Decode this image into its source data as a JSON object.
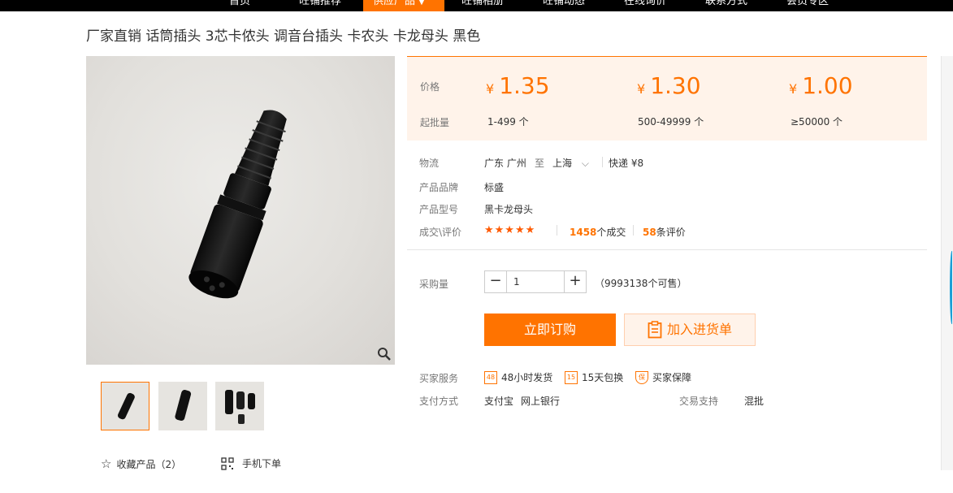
{
  "nav": {
    "items": [
      "首页",
      "旺铺推荐",
      "供应产品",
      "旺铺相册",
      "旺铺动态",
      "在线询价",
      "联系方式",
      "会员专区"
    ],
    "active_caret": "▼"
  },
  "product": {
    "title": "厂家直销 话筒插头 3芯卡侬头 调音台插头 卡农头 卡龙母头 黑色"
  },
  "price": {
    "price_label": "价格",
    "moq_label": "起批量",
    "currency": "¥",
    "tiers": [
      {
        "price": "1.35",
        "qty": "1-499 个"
      },
      {
        "price": "1.30",
        "qty": "500-49999 个"
      },
      {
        "price": "1.00",
        "qty": "≥50000 个"
      }
    ]
  },
  "logistics": {
    "label": "物流",
    "origin": "广东 广州",
    "to": "至",
    "destination": "上海",
    "express": "快递 ¥8"
  },
  "brand": {
    "label": "产品品牌",
    "value": "标盛"
  },
  "model": {
    "label": "产品型号",
    "value": "黑卡龙母头"
  },
  "deals": {
    "label": "成交\\评价",
    "rating": 4.5,
    "stars": "★★★★★",
    "deals_count": "1458",
    "deals_suffix": "个成交",
    "reviews_count": "58",
    "reviews_suffix": "条评价"
  },
  "purchase": {
    "label": "采购量",
    "quantity": "1",
    "minus": "−",
    "plus": "+",
    "stock": "（9993138个可售）",
    "buy_now": "立即订购",
    "add_to_list": "加入进货单"
  },
  "services": {
    "label": "买家服务",
    "items": [
      {
        "icon_text": "48",
        "label": "48小时发货"
      },
      {
        "icon_text": "15",
        "label": "15天包换"
      },
      {
        "icon_text": "保",
        "label": "买家保障"
      }
    ]
  },
  "payment": {
    "label": "支付方式",
    "methods": [
      "支付宝",
      "网上银行"
    ],
    "trade_label": "交易支持",
    "trade_value": "混批"
  },
  "footer": {
    "favorite": "收藏产品（2）",
    "mobile_order": "手机下单"
  },
  "colors": {
    "accent": "#ff7300",
    "price_bg": "#fff3ea",
    "nav_bg": "#000000"
  }
}
